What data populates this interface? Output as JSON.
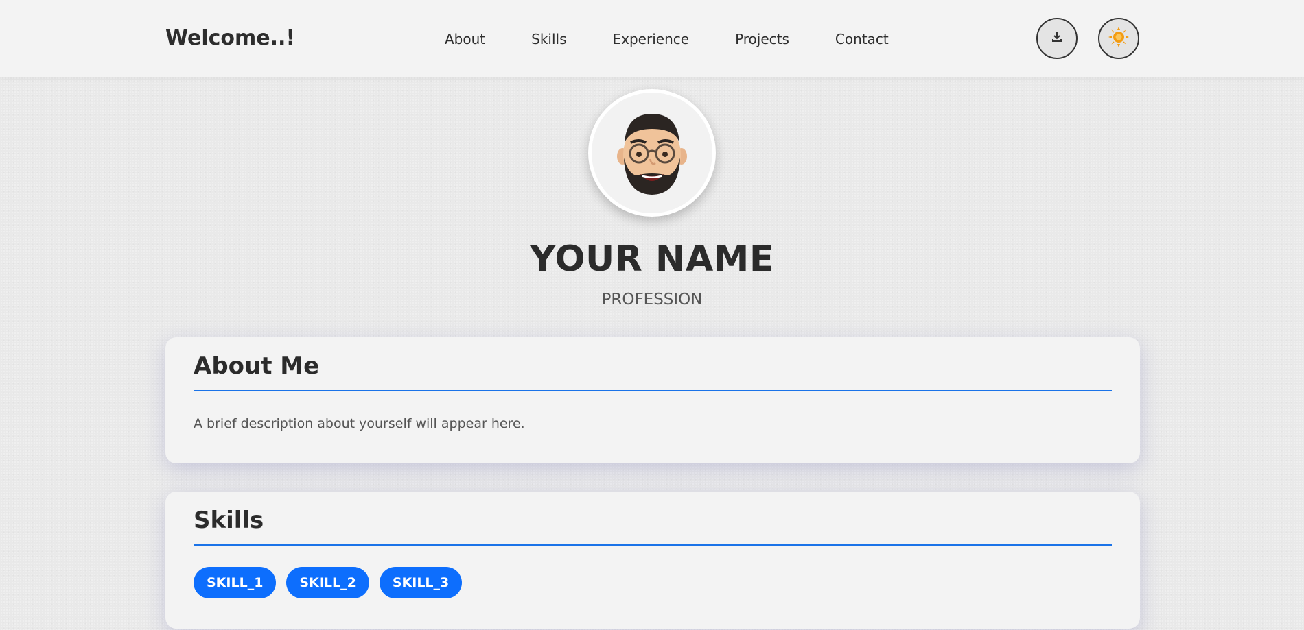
{
  "navbar": {
    "brand": "Welcome..!",
    "links": [
      "About",
      "Skills",
      "Experience",
      "Projects",
      "Contact"
    ],
    "download_icon": "download-icon",
    "theme_icon": "sun-icon"
  },
  "profile": {
    "avatar_icon": "memoji-avatar",
    "name": "YOUR NAME",
    "profession": "PROFESSION"
  },
  "about": {
    "title": "About Me",
    "text": "A brief description about yourself will appear here."
  },
  "skills": {
    "title": "Skills",
    "items": [
      "SKILL_1",
      "SKILL_2",
      "SKILL_3"
    ]
  },
  "colors": {
    "accent": "#0d6efd",
    "divider": "#1a73e8",
    "sun": "#f39c12"
  }
}
